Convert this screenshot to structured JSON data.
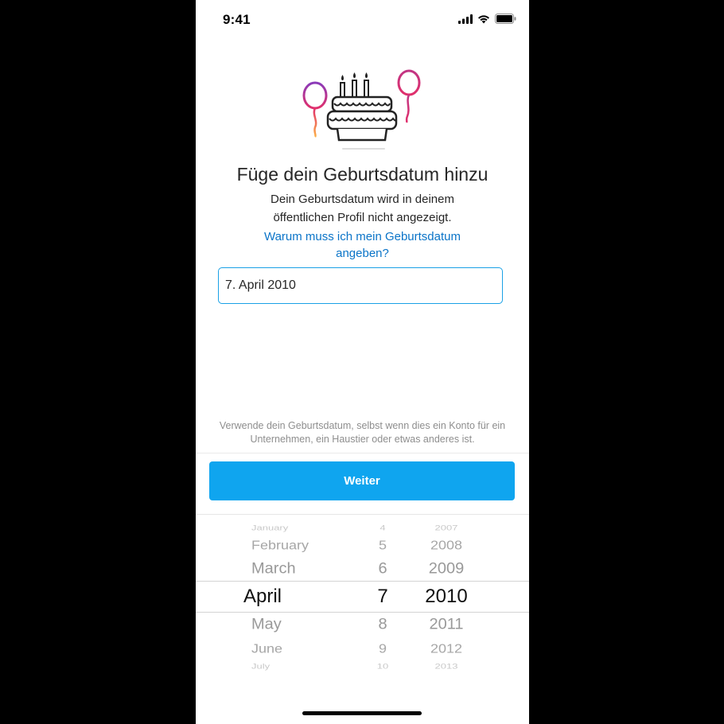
{
  "status_bar": {
    "time": "9:41",
    "icons": [
      "signal-icon",
      "wifi-icon",
      "battery-icon"
    ]
  },
  "illustration": "birthday-cake-with-balloons",
  "title": "Füge dein Geburtsdatum hinzu",
  "subtitle": "Dein Geburtsdatum wird in deinem öffentlichen Profil nicht angezeigt.",
  "why_link": "Warum muss ich mein Geburtsdatum angeben?",
  "date_field": {
    "value": "7. April 2010"
  },
  "note": "Verwende dein Geburtsdatum, selbst wenn dies ein Konto für ein Unternehmen, ein Haustier oder etwas anderes ist.",
  "continue_button": "Weiter",
  "picker": {
    "months": [
      "January",
      "February",
      "March",
      "April",
      "May",
      "June",
      "July"
    ],
    "days": [
      "4",
      "5",
      "6",
      "7",
      "8",
      "9",
      "10"
    ],
    "years": [
      "2007",
      "2008",
      "2009",
      "2010",
      "2011",
      "2012",
      "2013"
    ],
    "selected_index": 3
  },
  "colors": {
    "accent": "#0fa5ef",
    "link": "#0a74c8",
    "field_border": "#1aa1e6"
  }
}
